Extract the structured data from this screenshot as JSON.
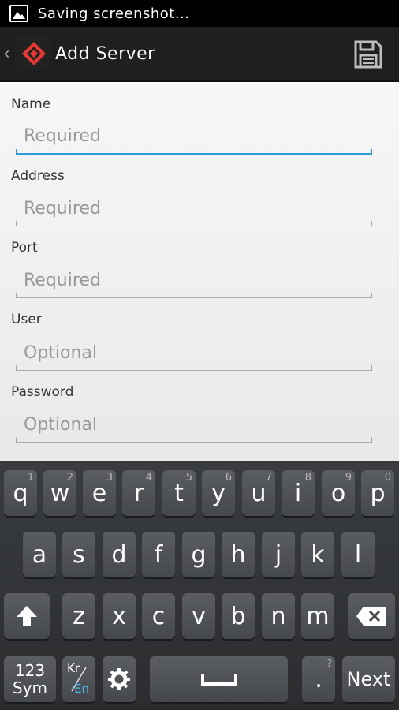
{
  "status_bar": {
    "notification": "Saving screenshot..."
  },
  "action_bar": {
    "title": "Add Server"
  },
  "form": {
    "fields": [
      {
        "label": "Name",
        "placeholder": "Required"
      },
      {
        "label": "Address",
        "placeholder": "Required"
      },
      {
        "label": "Port",
        "placeholder": "Required"
      },
      {
        "label": "User",
        "placeholder": "Optional"
      },
      {
        "label": "Password",
        "placeholder": "Optional"
      }
    ]
  },
  "keyboard": {
    "row1": [
      {
        "key": "q",
        "num": "1"
      },
      {
        "key": "w",
        "num": "2"
      },
      {
        "key": "e",
        "num": "3"
      },
      {
        "key": "r",
        "num": "4"
      },
      {
        "key": "t",
        "num": "5"
      },
      {
        "key": "y",
        "num": "6"
      },
      {
        "key": "u",
        "num": "7"
      },
      {
        "key": "i",
        "num": "8"
      },
      {
        "key": "o",
        "num": "9"
      },
      {
        "key": "p",
        "num": "0"
      }
    ],
    "row2": [
      "a",
      "s",
      "d",
      "f",
      "g",
      "h",
      "j",
      "k",
      "l"
    ],
    "row3": [
      "z",
      "x",
      "c",
      "v",
      "b",
      "n",
      "m"
    ],
    "sym_label_1": "123",
    "sym_label_2": "Sym",
    "lang_kr": "Kr",
    "lang_en": "En",
    "period": ".",
    "period_hint": "?",
    "next_label": "Next"
  },
  "colors": {
    "focus_accent": "#2f9bd6",
    "app_icon_red": "#e53935"
  }
}
